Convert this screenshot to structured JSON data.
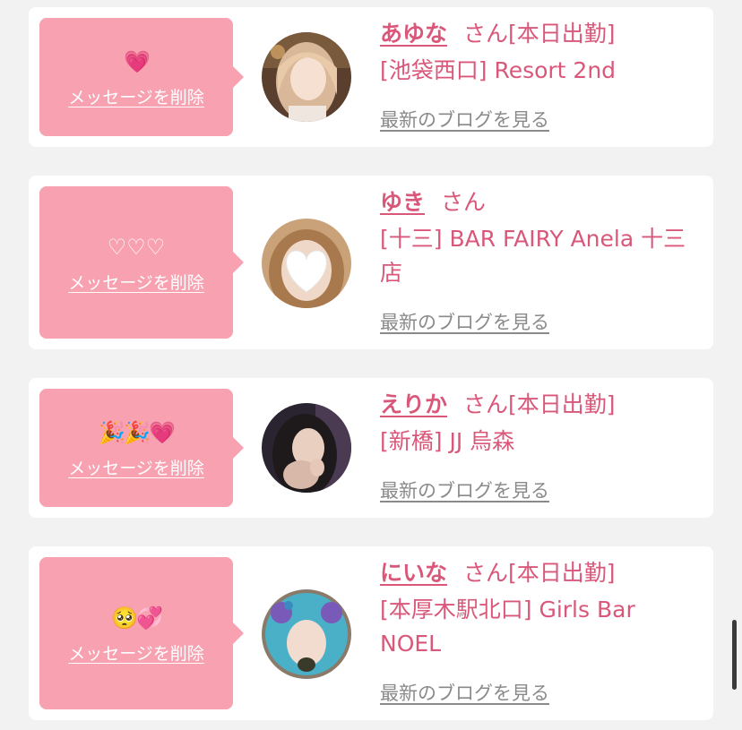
{
  "delete_label": "メッセージを削除",
  "blog_label": "最新のブログを見る",
  "colors": {
    "background": "#f2f2f2",
    "card": "#ffffff",
    "bubble": "#f7a1b1",
    "accent": "#d9587a",
    "link_gray": "#8a8a8a"
  },
  "entries": [
    {
      "message": "💗",
      "name": "あゆな",
      "suffix": "さん[本日出勤]",
      "shop": "[池袋西口] Resort 2nd",
      "avatar_icon": "woman-photo-avatar"
    },
    {
      "message": "♡♡♡",
      "name": "ゆき",
      "suffix": "さん",
      "shop": "[十三] BAR FAIRY Anela 十三店",
      "avatar_icon": "heart-covered-photo-avatar"
    },
    {
      "message": "🎉🎉💗",
      "name": "えりか",
      "suffix": "さん[本日出勤]",
      "shop": "[新橋] JJ 烏森",
      "avatar_icon": "woman-photo-avatar"
    },
    {
      "message": "🥺💞",
      "name": "にいな",
      "suffix": "さん[本日出勤]",
      "shop": "[本厚木駅北口] Girls Bar NOEL",
      "avatar_icon": "costume-photo-avatar"
    }
  ]
}
